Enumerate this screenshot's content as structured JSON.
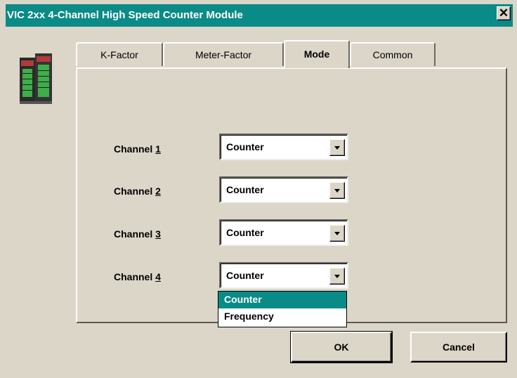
{
  "window": {
    "title": "VIC 2xx 4-Channel High Speed Counter Module",
    "close_symbol": "✕"
  },
  "tabs": [
    {
      "label": "K-Factor",
      "active": false
    },
    {
      "label": "Meter-Factor",
      "active": false
    },
    {
      "label": "Mode",
      "active": true
    },
    {
      "label": "Common",
      "active": false
    }
  ],
  "channels": [
    {
      "label_prefix": "Channel ",
      "label_num": "1",
      "value": "Counter"
    },
    {
      "label_prefix": "Channel ",
      "label_num": "2",
      "value": "Counter"
    },
    {
      "label_prefix": "Channel ",
      "label_num": "3",
      "value": "Counter"
    },
    {
      "label_prefix": "Channel ",
      "label_num": "4",
      "value": "Counter"
    }
  ],
  "dropdown": {
    "options": [
      "Counter",
      "Frequency"
    ],
    "selected": "Counter"
  },
  "buttons": {
    "ok": "OK",
    "cancel": "Cancel"
  },
  "colors": {
    "titlebar": "#0a8b87",
    "highlight": "#0a8b87",
    "dialog_bg": "#dcd6c9"
  }
}
